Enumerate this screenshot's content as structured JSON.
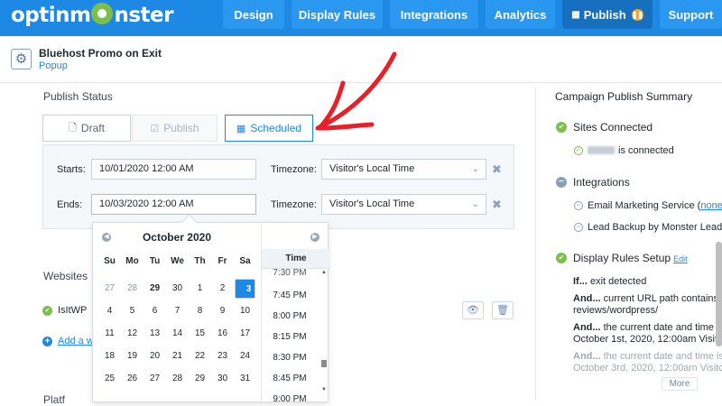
{
  "brand": {
    "logo_text_1": "optinm",
    "logo_text_2": "nster"
  },
  "nav": {
    "design": "Design",
    "display_rules": "Display Rules",
    "integrations": "Integrations",
    "analytics": "Analytics",
    "publish": "Publish",
    "support": "Support"
  },
  "campaign": {
    "name": "Bluehost Promo on Exit",
    "type": "Popup"
  },
  "publish_status": {
    "title": "Publish Status",
    "draft": "Draft",
    "publish": "Publish",
    "scheduled": "Scheduled"
  },
  "schedule": {
    "starts_label": "Starts:",
    "starts_value": "10/01/2020 12:00 AM",
    "ends_label": "Ends:",
    "ends_value": "10/03/2020 12:00 AM",
    "timezone_label": "Timezone:",
    "timezone_value": "Visitor's Local Time"
  },
  "websites": {
    "title": "Websites",
    "site": "IsItWP",
    "add": "Add a w",
    "platform": "Platf"
  },
  "calendar": {
    "month": "October 2020",
    "dows": [
      "Su",
      "Mo",
      "Tu",
      "We",
      "Th",
      "Fr",
      "Sa"
    ],
    "weeks": [
      [
        "27",
        "28",
        "29",
        "30",
        "1",
        "2",
        "3"
      ],
      [
        "4",
        "5",
        "6",
        "7",
        "8",
        "9",
        "10"
      ],
      [
        "11",
        "12",
        "13",
        "14",
        "15",
        "16",
        "17"
      ],
      [
        "18",
        "19",
        "20",
        "21",
        "22",
        "23",
        "24"
      ],
      [
        "25",
        "26",
        "27",
        "28",
        "29",
        "30",
        "31"
      ]
    ],
    "time_header": "Time",
    "times": [
      "7:30 PM",
      "7:45 PM",
      "8:00 PM",
      "8:15 PM",
      "8:30 PM",
      "8:45 PM",
      "9:00 PM"
    ]
  },
  "summary": {
    "title": "Campaign Publish Summary",
    "sites_connected": "Sites Connected",
    "is_connected": "is connected",
    "integrations": "Integrations",
    "email_service": "Email Marketing Service (",
    "email_none": "none",
    "email_close": ")",
    "lead_backup": "Lead Backup by Monster Leads (",
    "display_rules": "Display Rules Setup",
    "edit": "Edit",
    "if_label": "If...",
    "if_text": " exit detected",
    "and_label": "And...",
    "and1_text": " current URL path contains /ho",
    "and1_text2": "reviews/wordpress/",
    "and2_text": " the current date and time is o",
    "and2_text2": "October 1st, 2020, 12:00am Visitor's",
    "and3_text": " the current date and time is o",
    "and3_text2": "October 3rd, 2020, 12:00am Visitor's",
    "more": "More"
  }
}
